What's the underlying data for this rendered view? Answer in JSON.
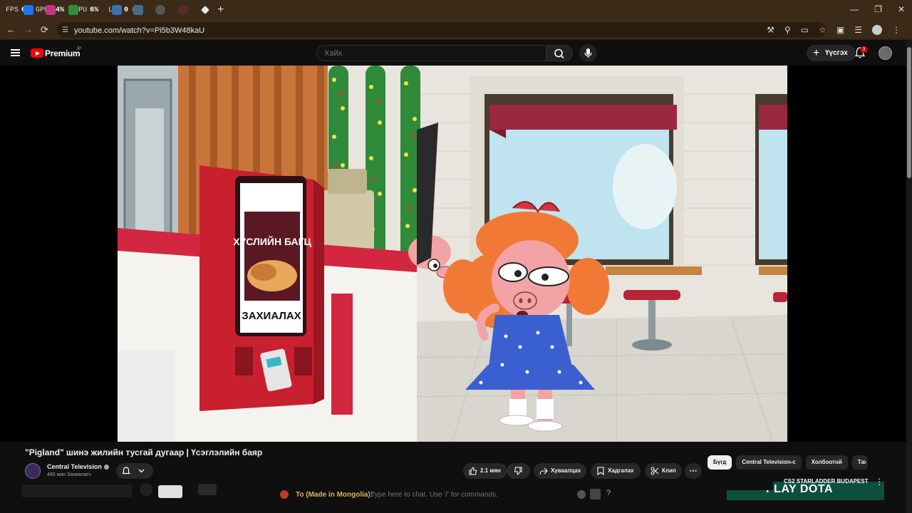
{
  "browser": {
    "overlay": [
      {
        "label": "FPS",
        "value": "6"
      },
      {
        "label": "GPU",
        "value": "14%"
      },
      {
        "label": "CPU",
        "value": "6%"
      },
      {
        "label": "LAT",
        "value": "0 ms"
      }
    ],
    "url": "youtube.com/watch?v=Pi5b3W48kaU"
  },
  "header": {
    "brand": "Premium",
    "region": "JP",
    "search_placeholder": "Хайх",
    "create_label": "Үүсгэх",
    "notification_count": "3"
  },
  "video": {
    "title": "\"Pigland\" шинэ жилийн тусгай дугаар | Үсэглэлийн баяр",
    "kiosk_top": "ХУСЛИЙН БАГЦ",
    "kiosk_order": "ЗАХИАЛАХ"
  },
  "channel": {
    "name": "Central Television",
    "subscribers": "460 мян Захиалагч"
  },
  "actions": {
    "likes": "2.1 мян",
    "share": "Хуваалцах",
    "save": "Хадгалах",
    "clip": "Клип"
  },
  "chips": [
    "Бүгд",
    "Central Television-с",
    "Холбоотой",
    "Та"
  ],
  "chat": {
    "to": "To (Made in Mongolia):",
    "placeholder": "Type here to chat. Use '/' for commands."
  },
  "recommendation": {
    "title": "CS2 STARLADDER BUDAPEST",
    "thumb_text": "PLAY DOTA"
  }
}
